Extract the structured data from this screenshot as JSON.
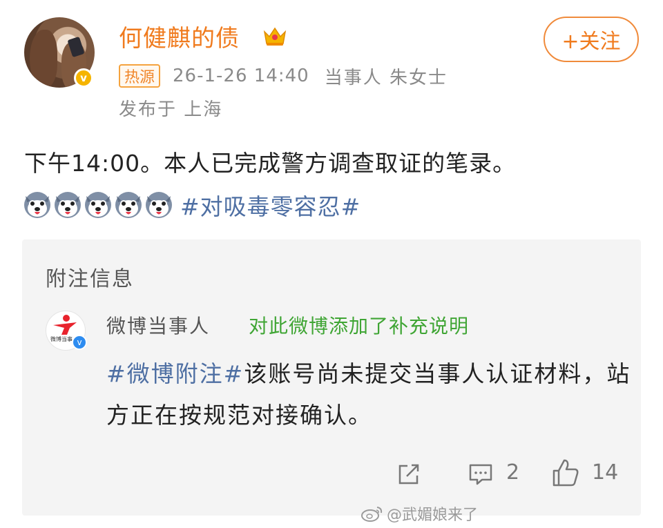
{
  "header": {
    "username": "何健麒的债",
    "follow_button": "+关注",
    "hot_tag": "热源",
    "time": "26-1-26 14:40",
    "source": "当事人 朱女士",
    "location": "发布于 上海"
  },
  "post": {
    "text": "下午14:00。本人已完成警方调查取证的笔录。",
    "emoji_count": 5,
    "hashtag": "#对吸毒零容忍#"
  },
  "note": {
    "header": "附注信息",
    "logo_text": "微博当事",
    "author": "微博当事人",
    "action": "对此微博添加了补充说明",
    "hashtag": "#微博附注#",
    "text": "该账号尚未提交当事人认证材料，站方正在按规范对接确认。"
  },
  "actions": {
    "comments": "2",
    "likes": "14"
  },
  "watermark": "@武媚娘来了",
  "colors": {
    "username": "#f07b1e",
    "hashtag": "#4e6fa3",
    "note_action": "#3fa534",
    "meta": "#8a8a8a"
  }
}
